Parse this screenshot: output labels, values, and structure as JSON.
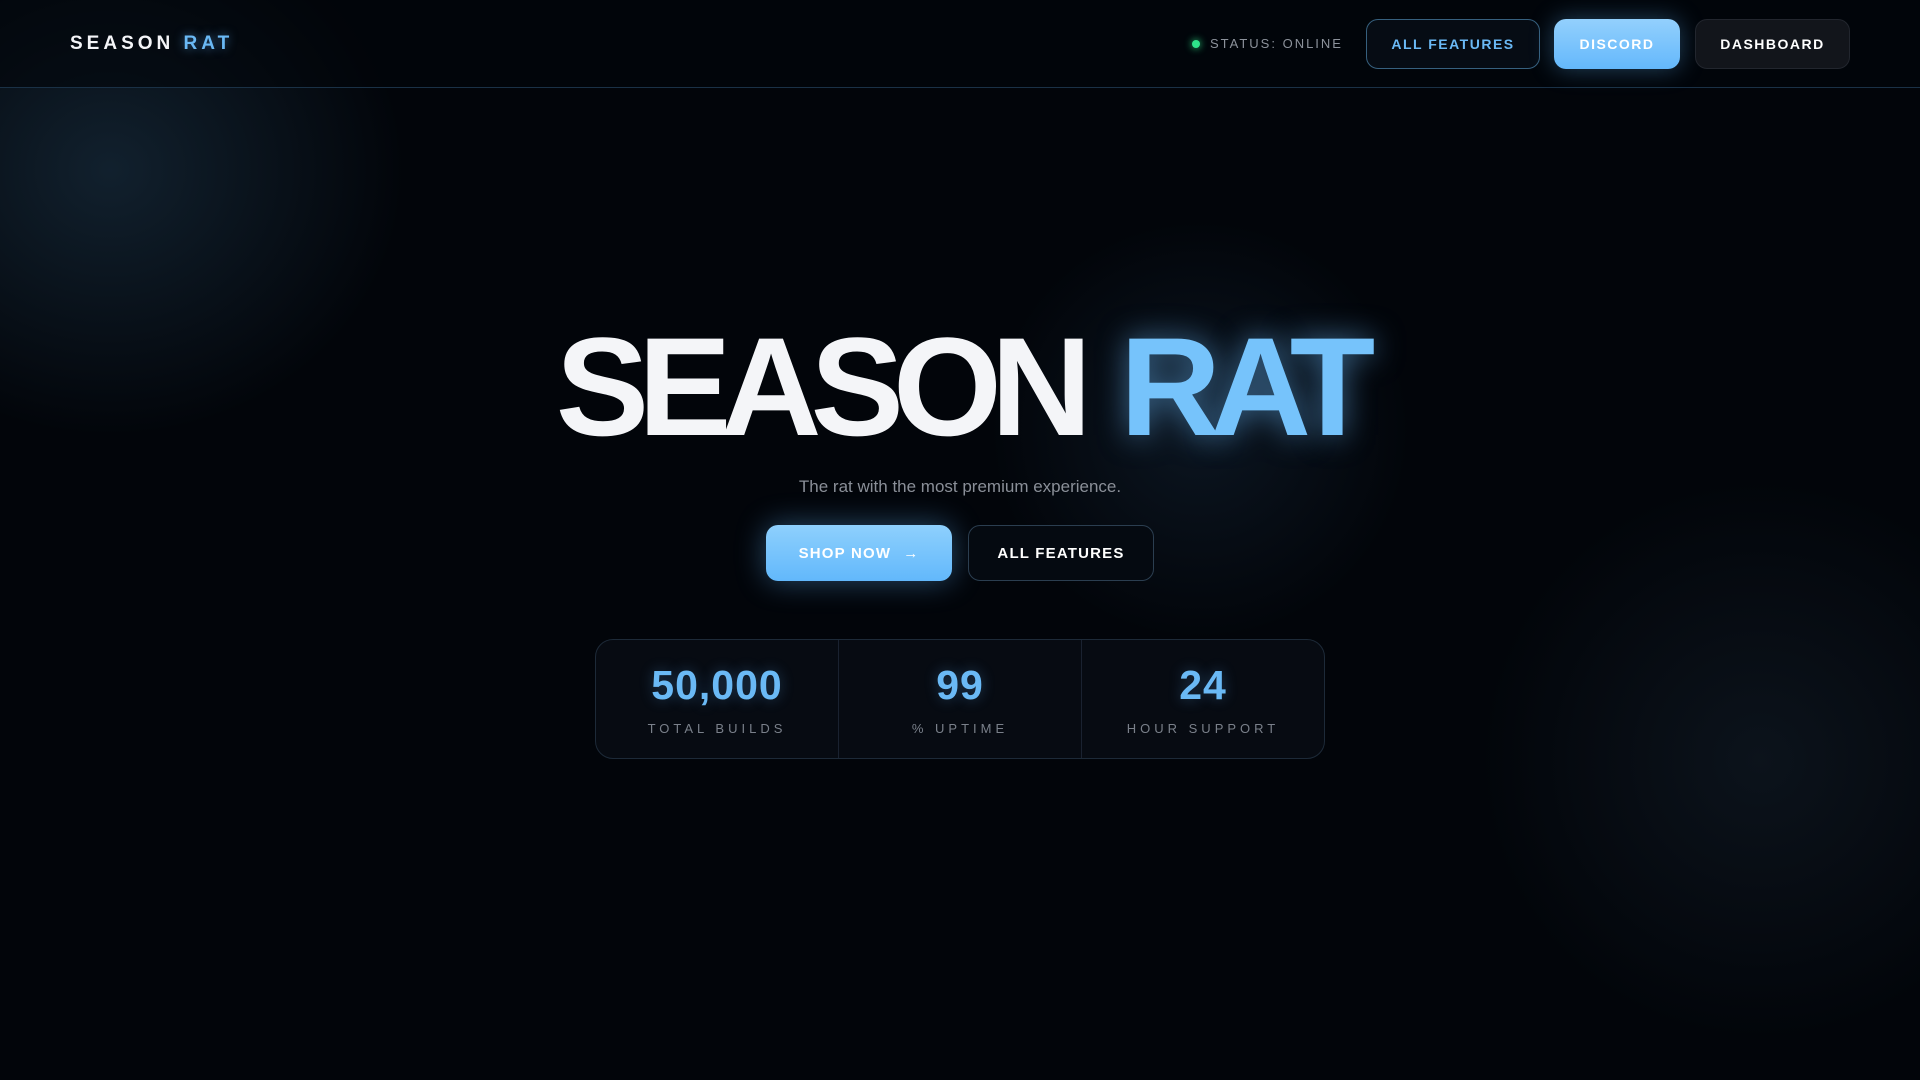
{
  "nav": {
    "logo": {
      "part1": "SEASON",
      "part2": "RAT"
    },
    "status": "STATUS: ONLINE",
    "buttons": {
      "features": "ALL FEATURES",
      "discord": "DISCORD",
      "dashboard": "DASHBOARD"
    }
  },
  "hero": {
    "title1": "SEASON",
    "title2": "RAT",
    "subtitle": "The rat with the most premium experience.",
    "shop": "SHOP NOW",
    "shop_arrow": "→",
    "features": "ALL FEATURES"
  },
  "stats": [
    {
      "value": "50,000",
      "label": "TOTAL BUILDS"
    },
    {
      "value": "99",
      "label": "% UPTIME"
    },
    {
      "value": "24",
      "label": "HOUR SUPPORT"
    }
  ],
  "colors": {
    "accent": "#6ab9f5",
    "status": "#2ee38a",
    "background": "#02050a"
  }
}
